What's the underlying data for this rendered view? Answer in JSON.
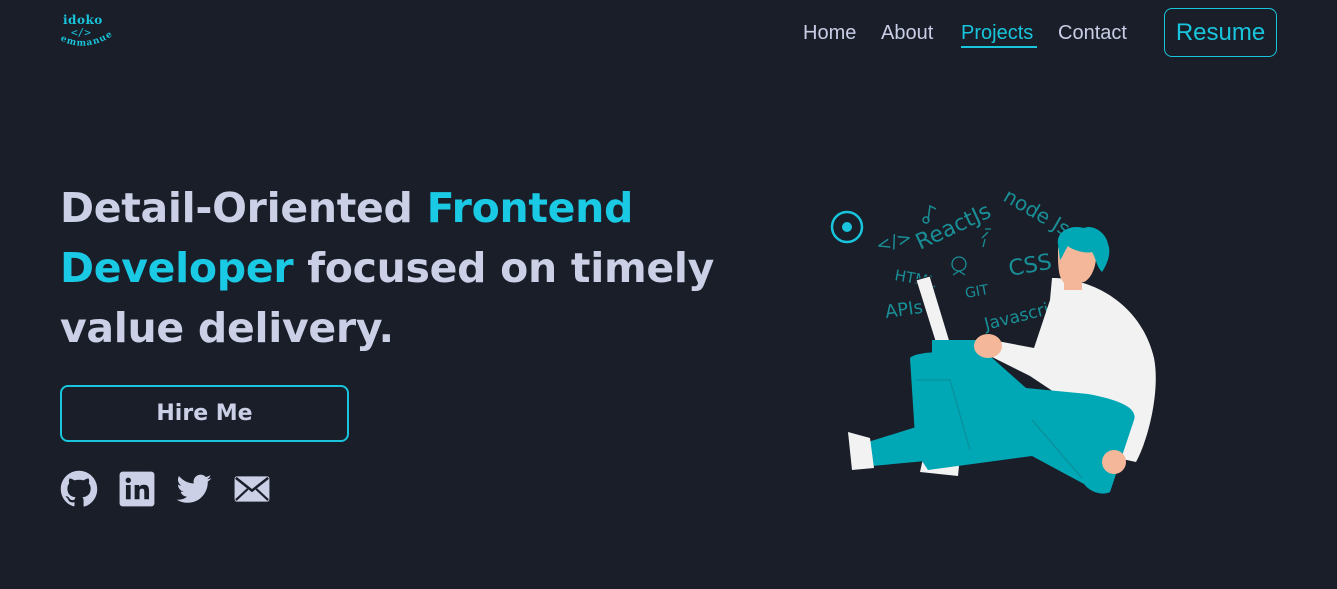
{
  "logo": {
    "line1": "idoko",
    "line2": "</>",
    "line3": "emmanuel"
  },
  "nav": {
    "links": [
      {
        "label": "Home"
      },
      {
        "label": "About"
      },
      {
        "label": "Projects",
        "active": true
      },
      {
        "label": "Contact"
      }
    ],
    "resume_label": "Resume"
  },
  "hero": {
    "title_part1": "Detail-Oriented ",
    "title_accent": "Frontend Developer",
    "title_part2": " focused on timely value delivery.",
    "cta_label": "Hire Me"
  },
  "socials": [
    {
      "icon": "github-icon"
    },
    {
      "icon": "linkedin-icon"
    },
    {
      "icon": "twitter-icon"
    },
    {
      "icon": "mail-icon"
    }
  ],
  "illustration": {
    "tech_words": [
      "</>",
      "ReactJs",
      "node Js",
      "HTML",
      "GIT",
      "CSS",
      "APIs",
      "Javascript"
    ]
  },
  "colors": {
    "background": "#191e29",
    "accent": "#18c5dc",
    "text": "#ccd0e6"
  }
}
